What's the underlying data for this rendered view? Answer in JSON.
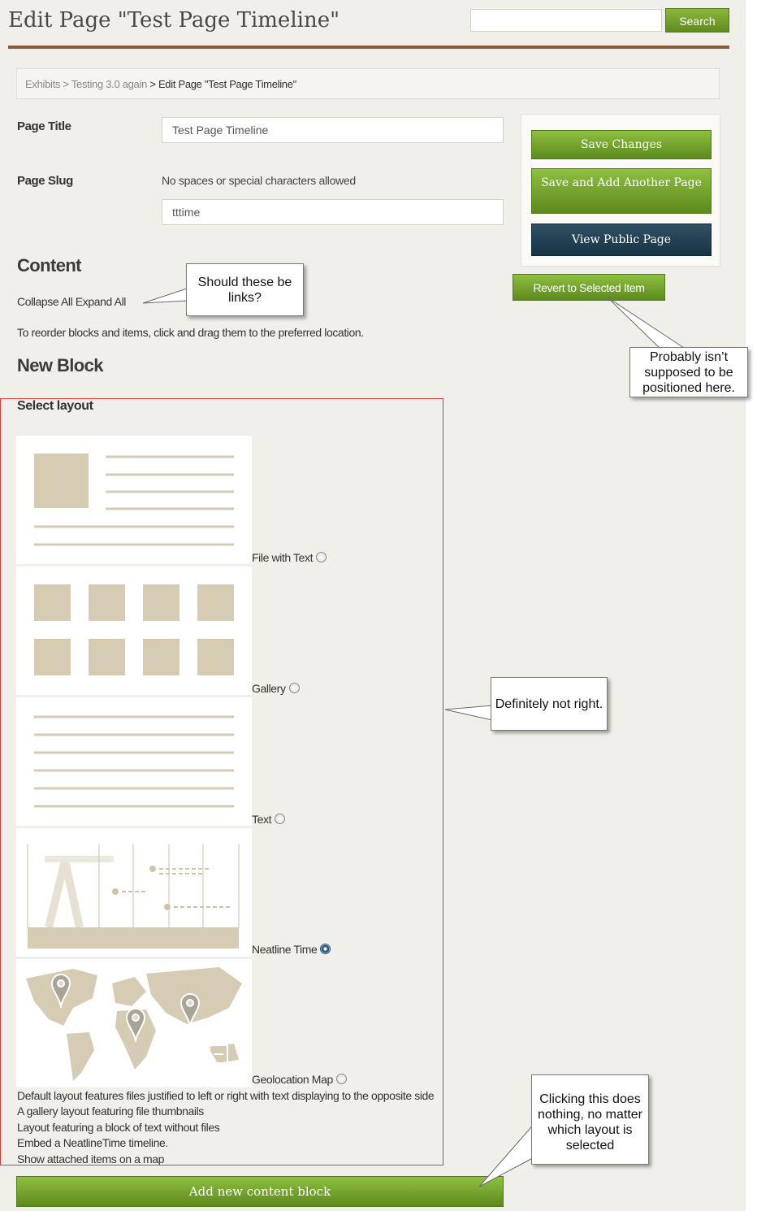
{
  "header": {
    "title": "Edit Page \"Test Page Timeline\"",
    "search_placeholder": "",
    "search_button": "Search"
  },
  "breadcrumb": {
    "item1": "Exhibits",
    "sep1": " > ",
    "item2": "Testing 3.0 again",
    "sep2": " > ",
    "current": "Edit Page \"Test Page Timeline\""
  },
  "form": {
    "page_title_label": "Page Title",
    "page_title_value": "Test Page Timeline",
    "page_slug_label": "Page Slug",
    "page_slug_hint": "No spaces or special characters allowed",
    "page_slug_value": "tttime"
  },
  "actions": {
    "save_changes": "Save Changes",
    "save_add_another": "Save and Add Another Page",
    "view_public": "View Public Page",
    "revert": "Revert to Selected Item"
  },
  "content": {
    "heading": "Content",
    "collapse_all": "Collapse All",
    "expand_all": "Expand All",
    "reorder_hint": "To reorder blocks and items, click and drag them to the preferred location."
  },
  "new_block": {
    "heading": "New Block",
    "select_layout": "Select layout",
    "layouts": [
      {
        "label": "File with Text",
        "selected": false
      },
      {
        "label": "Gallery",
        "selected": false
      },
      {
        "label": "Text",
        "selected": false
      },
      {
        "label": "Neatline Time",
        "selected": true
      },
      {
        "label": "Geolocation Map",
        "selected": false
      }
    ],
    "descriptions": [
      "Default layout features files justified to left or right with text displaying to the opposite side",
      "A gallery layout featuring file thumbnails",
      "Layout featuring a block of text without files",
      "Embed a NeatlineTime timeline.",
      "Show attached items on a map"
    ],
    "add_button": "Add new content block"
  },
  "annotations": {
    "links_note": "Should  these be links?",
    "revert_note": "Probably isn’t supposed to be positioned  here.",
    "layout_note": "Definitely not right.",
    "add_note": "Clicking this does nothing, no matter which layout is selected"
  },
  "colors": {
    "accent_green": "#6d9a2a",
    "dark_button": "#1f3d4f",
    "header_rule": "#8a5a3c",
    "thumb_tan": "#d6cbb3",
    "annotation_border": "#e2393b"
  }
}
